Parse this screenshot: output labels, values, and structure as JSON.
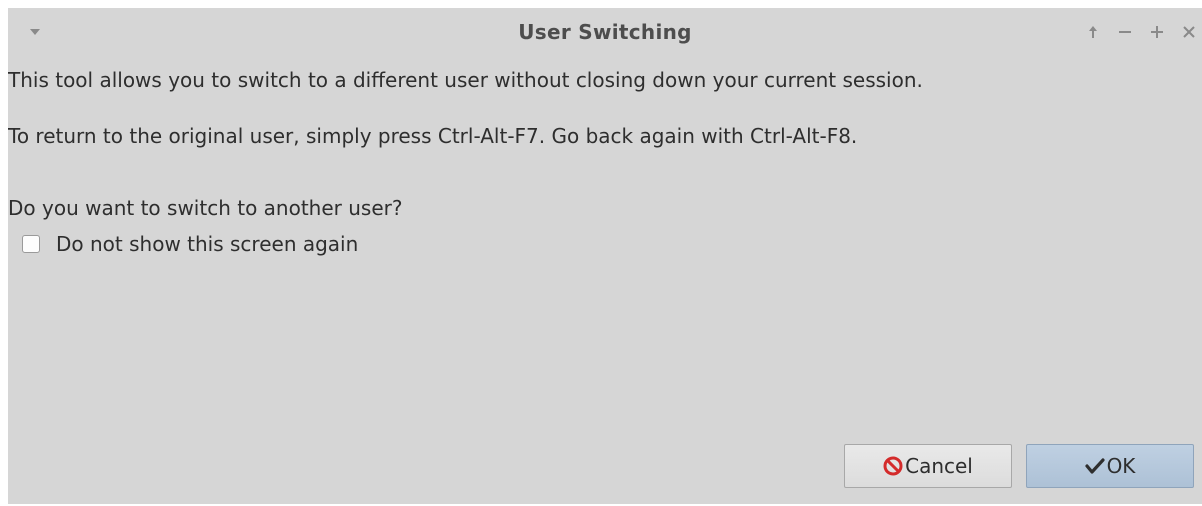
{
  "window": {
    "title": "User Switching"
  },
  "icons": {
    "menu": "triangle-down-icon",
    "raise": "arrow-up-icon",
    "minimize": "minus-icon",
    "maximize": "plus-icon",
    "close": "x-icon",
    "cancel": "no-entry-icon",
    "ok": "checkmark-icon"
  },
  "colors": {
    "window_bg": "#d6d6d6",
    "ok_button_bg": "#b7c9dc",
    "cancel_icon_red": "#d42b2b"
  },
  "body": {
    "line1": "This tool allows you to switch to a different user without closing down your current session.",
    "line2": "To return to the original user, simply press Ctrl-Alt-F7. Go back again with Ctrl-Alt-F8.",
    "question": "Do you want to switch to another user?",
    "checkbox_label": "Do not show this screen again",
    "checkbox_checked": false
  },
  "buttons": {
    "cancel_label": "Cancel",
    "ok_label": "OK"
  }
}
